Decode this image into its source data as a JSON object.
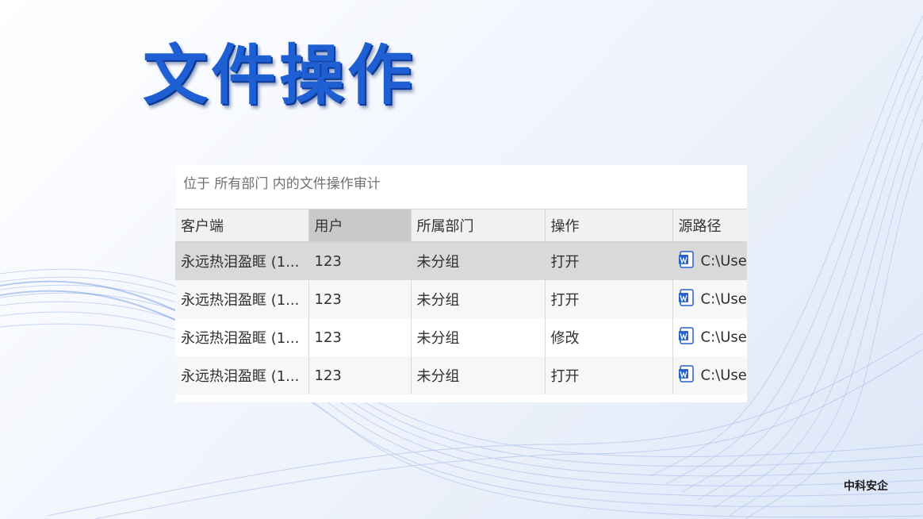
{
  "slide": {
    "title": "文件操作",
    "brand": "中科安企"
  },
  "panel": {
    "caption": "位于 所有部门 内的文件操作审计",
    "columns": [
      "客户端",
      "用户",
      "所属部门",
      "操作",
      "源路径"
    ],
    "rows": [
      {
        "client": "永远热泪盈眶 (1...",
        "user": "123",
        "dept": "未分组",
        "op": "打开",
        "path": "C:\\Use",
        "icon": "word-doc-icon"
      },
      {
        "client": "永远热泪盈眶 (1...",
        "user": "123",
        "dept": "未分组",
        "op": "打开",
        "path": "C:\\Use",
        "icon": "word-doc-icon"
      },
      {
        "client": "永远热泪盈眶 (1...",
        "user": "123",
        "dept": "未分组",
        "op": "修改",
        "path": "C:\\Use",
        "icon": "word-doc-icon"
      },
      {
        "client": "永远热泪盈眶 (1...",
        "user": "123",
        "dept": "未分组",
        "op": "打开",
        "path": "C:\\Use",
        "icon": "word-doc-icon"
      }
    ]
  },
  "colors": {
    "title": "#1f5fd4",
    "selected_row": "#d9d9d9",
    "sorted_header": "#c9c9c9",
    "word_blue": "#2b5fcc"
  }
}
